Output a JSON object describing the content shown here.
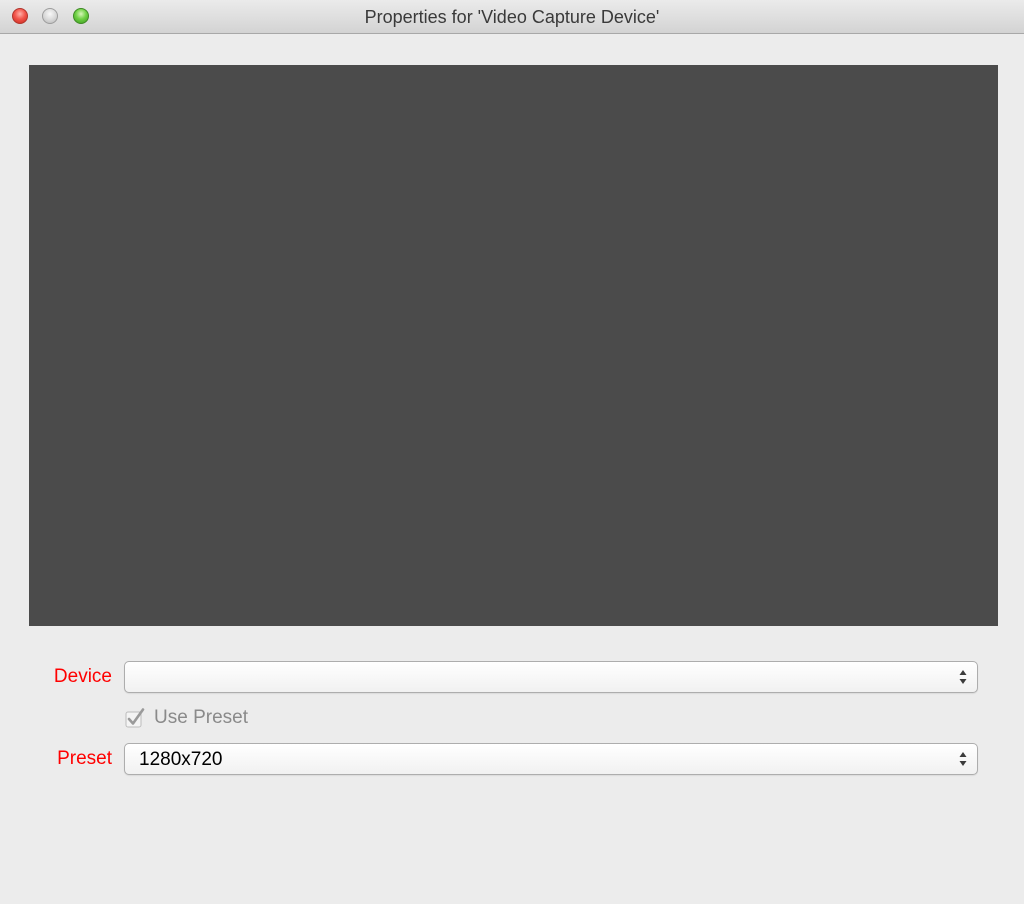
{
  "window": {
    "title": "Properties for 'Video Capture Device'"
  },
  "titlebar": {
    "buttons": [
      {
        "name": "close",
        "color": "#f2564c"
      },
      {
        "name": "minimize",
        "color": "#d7d7d7"
      },
      {
        "name": "zoom",
        "color": "#6fd145"
      }
    ]
  },
  "preview": {
    "background_color": "#4b4b4b"
  },
  "form": {
    "device": {
      "label": "Device",
      "value": ""
    },
    "use_preset": {
      "label": "Use Preset",
      "checked": true,
      "enabled": false
    },
    "preset": {
      "label": "Preset",
      "value": "1280x720"
    },
    "label_color": "#ff0000"
  }
}
